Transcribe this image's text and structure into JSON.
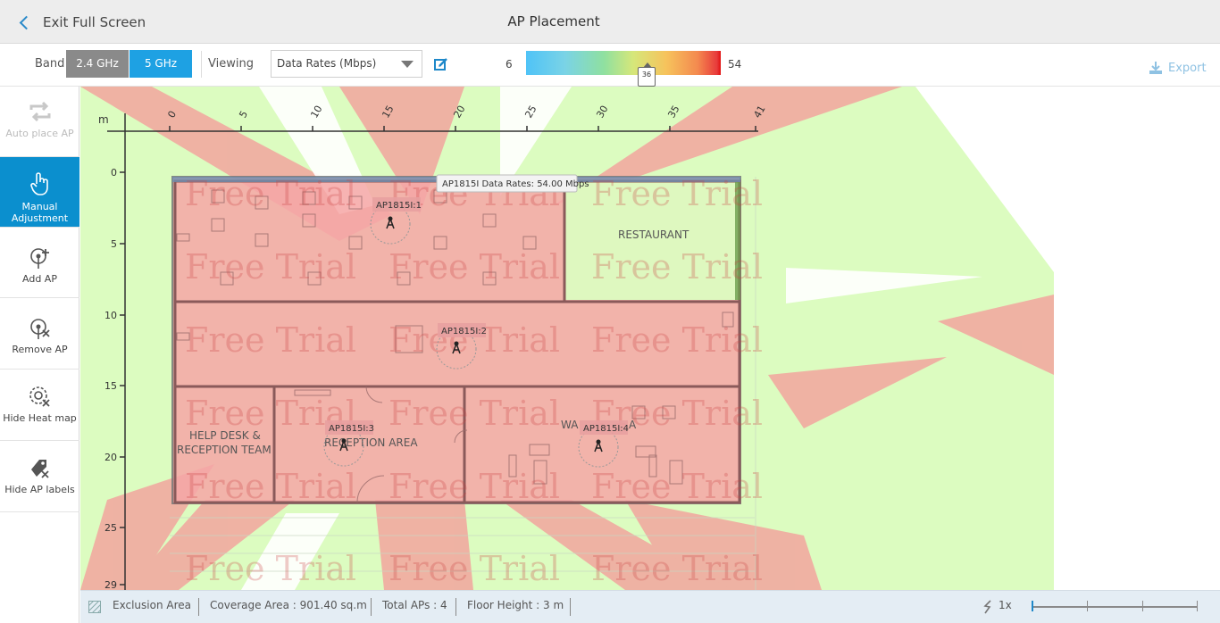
{
  "header": {
    "exit_label": "Exit Full Screen",
    "title": "AP Placement"
  },
  "toolbar": {
    "band_label": "Band",
    "band_options": [
      "2.4 GHz",
      "5 GHz"
    ],
    "band_selected": "5 GHz",
    "viewing_label": "Viewing",
    "viewing_value": "Data Rates (Mbps)",
    "scale_min": "6",
    "scale_max": "54",
    "scale_marker": "36",
    "export_label": "Export"
  },
  "sidebar": {
    "items": [
      {
        "label": "Auto place AP",
        "icon": "auto-place-icon",
        "state": "disabled"
      },
      {
        "label": "Manual Adjustment",
        "icon": "hand-pointer-icon",
        "state": "active"
      },
      {
        "label": "Add AP",
        "icon": "add-ap-icon",
        "state": "normal"
      },
      {
        "label": "Remove AP",
        "icon": "remove-ap-icon",
        "state": "normal"
      },
      {
        "label": "Hide Heat map",
        "icon": "hide-heatmap-icon",
        "state": "normal"
      },
      {
        "label": "Hide AP labels",
        "icon": "hide-labels-icon",
        "state": "normal"
      }
    ]
  },
  "floorplan": {
    "unit": "m",
    "x_ticks": [
      "0",
      "5",
      "10",
      "15",
      "20",
      "25",
      "30",
      "35",
      "41"
    ],
    "y_ticks": [
      "0",
      "5",
      "10",
      "15",
      "20",
      "25",
      "29"
    ],
    "watermark": "Free Trial",
    "tooltip": "AP1815I Data Rates: 54.00 Mbps",
    "rooms": [
      "RESTAURANT",
      "HELP DESK &",
      "RECEPTION TEAM",
      "RECEPTION AREA",
      "WA",
      "A"
    ],
    "aps": [
      "AP1815I:1",
      "AP1815I:2",
      "AP1815I:3",
      "AP1815I:4"
    ]
  },
  "status": {
    "exclusion": "Exclusion Area",
    "coverage": "Coverage Area : 901.40  sq.m",
    "total_aps": "Total APs : 4",
    "floor_height": "Floor Height : 3 m",
    "zoom": "1x"
  },
  "colors": {
    "accent": "#1ea1e3",
    "active_sidebar": "#0b8fce",
    "coverage_red": "#f08a8a",
    "coverage_green": "#d6ffb8"
  }
}
